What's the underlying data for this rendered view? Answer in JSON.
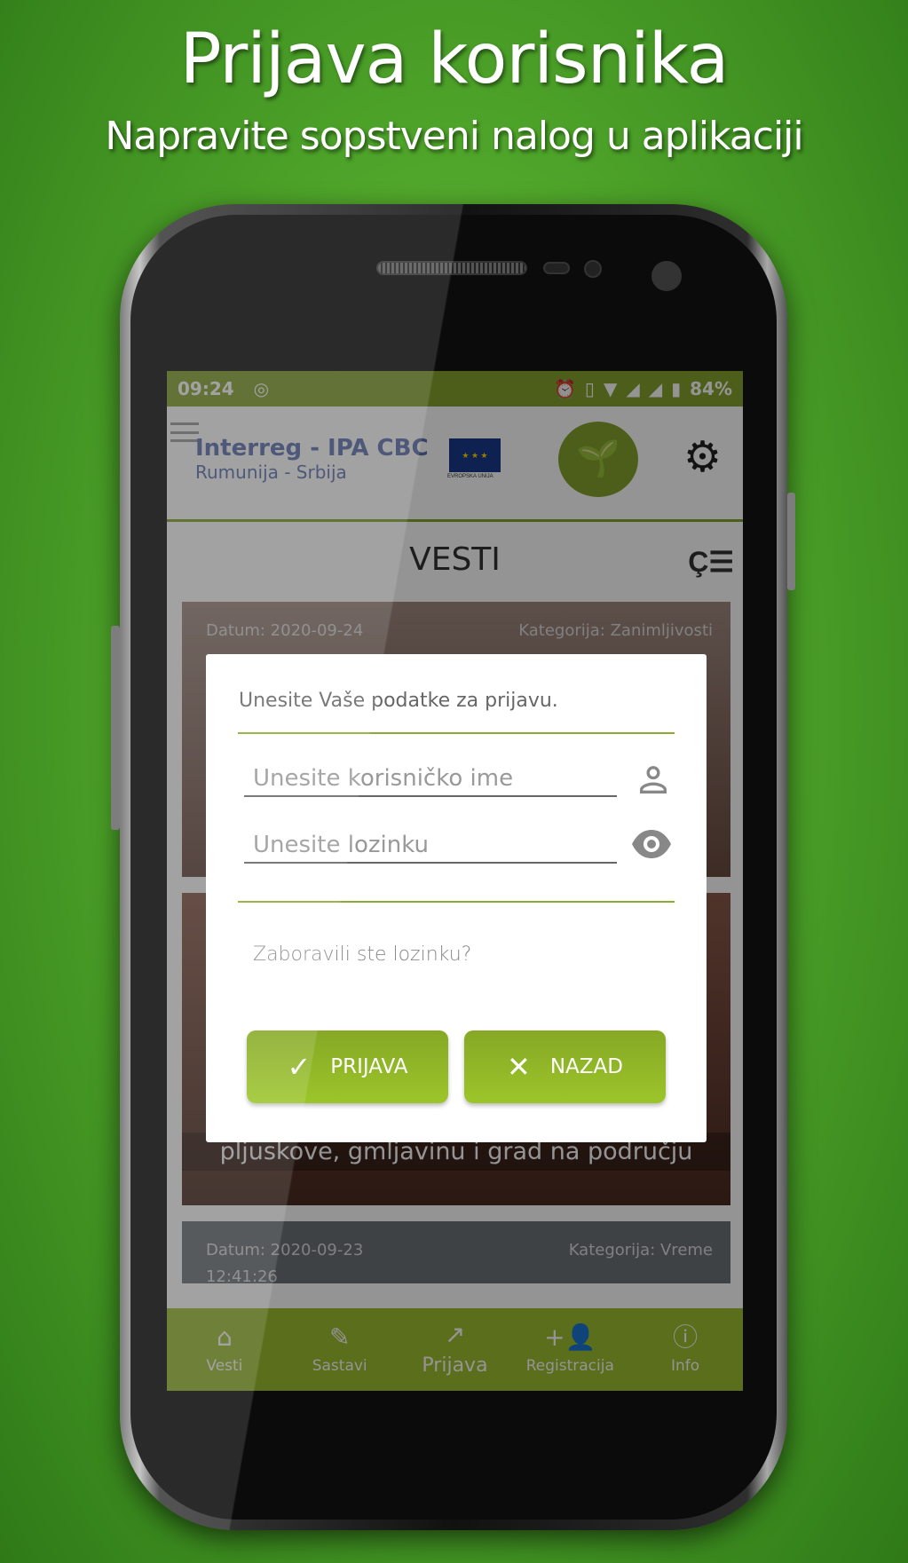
{
  "hero": {
    "title": "Prijava korisnika",
    "subtitle": "Napravite sopstveni nalog u aplikaciji"
  },
  "statusbar": {
    "time": "09:24",
    "battery": "84%",
    "icons": [
      "alarm-icon",
      "vibrate-icon",
      "wifi-icon",
      "signal-icon",
      "signal-x-icon",
      "battery-charging-icon"
    ]
  },
  "appbar": {
    "logo_line1": "Interreg - IPA CBC",
    "logo_line2": "Rumunija - Srbija",
    "eu_label": "EVROPSKA UNIJA"
  },
  "section": {
    "title": "VESTI"
  },
  "cards": [
    {
      "date": "Datum: 2020-09-24",
      "category": "Kategorija: Zanimljivosti"
    },
    {
      "headline": "pljuskove, gmljavinu i grad na području"
    },
    {
      "date": "Datum: 2020-09-23",
      "time": "12:41:26",
      "category": "Kategorija: Vreme"
    }
  ],
  "dialog": {
    "title": "Unesite Vaše podatke za prijavu.",
    "username_placeholder": "Unesite korisničko ime",
    "password_placeholder": "Unesite lozinku",
    "forgot": "Zaboravili ste lozinku?",
    "login_label": "PRIJAVA",
    "back_label": "NAZAD"
  },
  "bottomnav": [
    {
      "label": "Vesti",
      "icon": "home-icon"
    },
    {
      "label": "Sastavi",
      "icon": "pencil-icon"
    },
    {
      "label": "Prijava",
      "icon": "arrow-up-right-icon"
    },
    {
      "label": "Registracija",
      "icon": "add-person-icon"
    },
    {
      "label": "Info",
      "icon": "info-icon"
    }
  ],
  "colors": {
    "brand_green": "#83a32b",
    "button_green": "#9cc52a"
  }
}
